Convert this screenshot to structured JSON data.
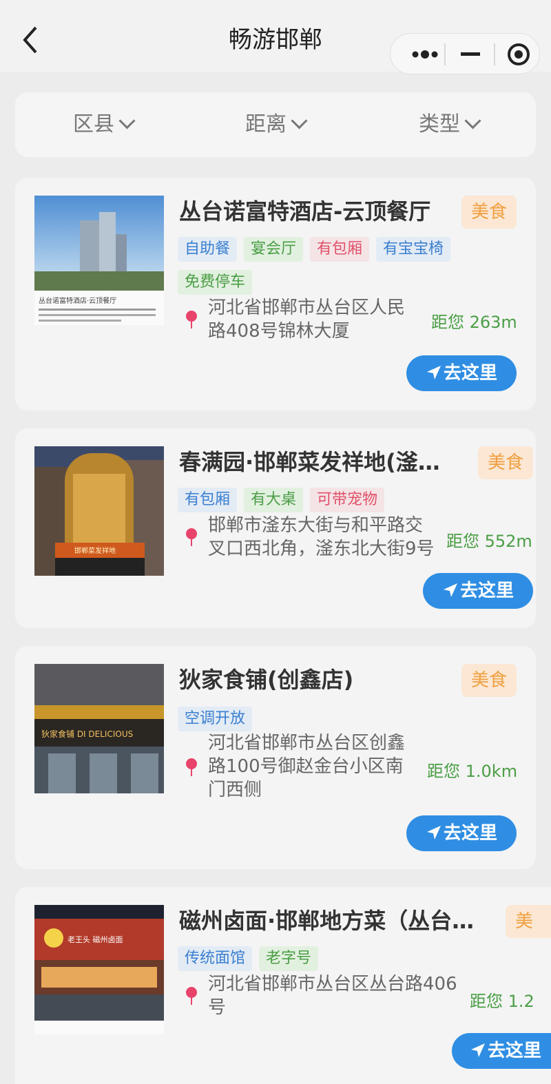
{
  "nav": {
    "title": "畅游邯郸"
  },
  "filters": [
    {
      "label": "区县"
    },
    {
      "label": "距离"
    },
    {
      "label": "类型"
    }
  ],
  "cards": [
    {
      "title": "丛台诺富特酒店-云顶餐厅",
      "category": "美食",
      "thumb_caption": "丛台诺富特酒店·云顶餐厅",
      "tags": [
        {
          "text": "自助餐",
          "color": "blue"
        },
        {
          "text": "宴会厅",
          "color": "green"
        },
        {
          "text": "有包厢",
          "color": "red"
        },
        {
          "text": "有宝宝椅",
          "color": "blue"
        },
        {
          "text": "免费停车",
          "color": "green"
        }
      ],
      "address_lines": [
        "河北省邯郸市丛台区人民",
        "路408号锦林大厦"
      ],
      "distance": "距您 263m",
      "go_label": "去这里"
    },
    {
      "title": "春满园·邯郸菜发祥地(滏…",
      "category": "美食",
      "thumb_caption": "邯郸菜发祥地",
      "tags": [
        {
          "text": "有包厢",
          "color": "blue"
        },
        {
          "text": "有大桌",
          "color": "green"
        },
        {
          "text": "可带宠物",
          "color": "red"
        }
      ],
      "address_lines": [
        "邯郸市滏东大街与和平路交",
        "叉口西北角，滏东北大街9号"
      ],
      "distance": "距您 552m",
      "go_label": "去这里"
    },
    {
      "title": "狄家食铺(创鑫店)",
      "category": "美食",
      "thumb_caption": "狄家食铺 DI DELICIOUS",
      "tags": [
        {
          "text": "空调开放",
          "color": "blue"
        }
      ],
      "address_lines": [
        "河北省邯郸市丛台区创鑫",
        "路100号御赵金台小区南",
        "门西侧"
      ],
      "distance": "距您 1.0km",
      "go_label": "去这里"
    },
    {
      "title": "磁州卤面·邯郸地方菜（丛台…",
      "category": "美",
      "thumb_caption": "老王头 磁州卤面",
      "tags": [
        {
          "text": "传统面馆",
          "color": "blue"
        },
        {
          "text": "老字号",
          "color": "green"
        }
      ],
      "address_lines": [
        "河北省邯郸市丛台区丛台路406",
        "号"
      ],
      "distance": "距您 1.2",
      "go_label": "去这里"
    }
  ],
  "colors": {
    "primary_button": "#2f8ee3",
    "category_badge_bg": "#fbe7d4",
    "category_badge_text": "#f0a040",
    "distance_text": "#4a9e45",
    "pin": "#e8436b"
  }
}
